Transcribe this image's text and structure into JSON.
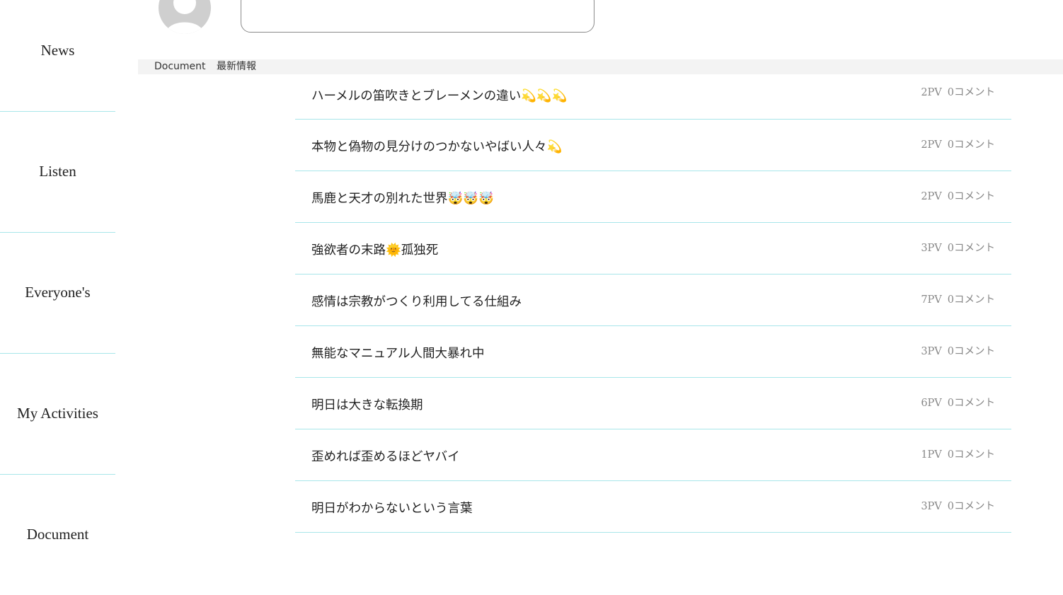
{
  "sidebar": {
    "items": [
      {
        "label": "News"
      },
      {
        "label": "Listen"
      },
      {
        "label": "Everyone's"
      },
      {
        "label": "My Activities"
      },
      {
        "label": "Document"
      }
    ]
  },
  "search": {
    "placeholder": ""
  },
  "breadcrumb": {
    "section": "Document",
    "page": "最新情報"
  },
  "posts": [
    {
      "title": "ハーメルの笛吹きとブレーメンの違い💫💫💫",
      "views": "2PV",
      "comments": "0コメント"
    },
    {
      "title": "本物と偽物の見分けのつかないやばい人々💫",
      "views": "2PV",
      "comments": "0コメント"
    },
    {
      "title": "馬鹿と天才の別れた世界🤯🤯🤯",
      "views": "2PV",
      "comments": "0コメント"
    },
    {
      "title": "強欲者の末路🌞孤独死",
      "views": "3PV",
      "comments": "0コメント"
    },
    {
      "title": "感情は宗教がつくり利用してる仕組み",
      "views": "7PV",
      "comments": "0コメント"
    },
    {
      "title": "無能なマニュアル人間大暴れ中",
      "views": "3PV",
      "comments": "0コメント"
    },
    {
      "title": "明日は大きな転換期",
      "views": "6PV",
      "comments": "0コメント"
    },
    {
      "title": "歪めれば歪めるほどヤバイ",
      "views": "1PV",
      "comments": "0コメント"
    },
    {
      "title": "明日がわからないという言葉",
      "views": "3PV",
      "comments": "0コメント"
    }
  ],
  "colors": {
    "divider": "#a8e6ea",
    "breadcrumb_bg": "#f3f3f3",
    "avatar": "#cfcfcf"
  }
}
